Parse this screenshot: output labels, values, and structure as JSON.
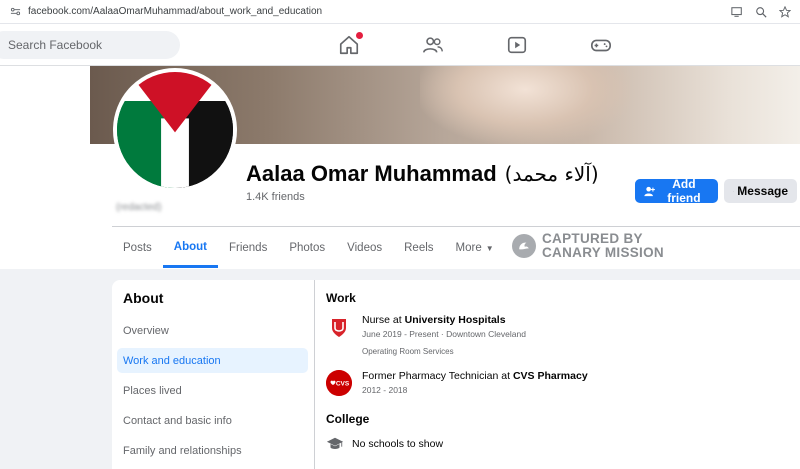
{
  "browser": {
    "url": "facebook.com/AalaaOmarMuhammad/about_work_and_education"
  },
  "topnav": {
    "search_placeholder": "Search Facebook"
  },
  "profile": {
    "name": "Aalaa Omar Muhammad",
    "alt_name": "(آلاء محمد)",
    "friends": "1.4K friends",
    "blurred_text": "(redacted)"
  },
  "actions": {
    "add_friend": "Add friend",
    "message": "Message"
  },
  "tabs": [
    {
      "label": "Posts"
    },
    {
      "label": "About"
    },
    {
      "label": "Friends"
    },
    {
      "label": "Photos"
    },
    {
      "label": "Videos"
    },
    {
      "label": "Reels"
    },
    {
      "label": "More"
    }
  ],
  "watermark": {
    "line1": "CAPTURED BY",
    "line2": "CANARY MISSION"
  },
  "about": {
    "title": "About",
    "items": [
      {
        "label": "Overview"
      },
      {
        "label": "Work and education"
      },
      {
        "label": "Places lived"
      },
      {
        "label": "Contact and basic info"
      },
      {
        "label": "Family and relationships"
      }
    ]
  },
  "work": {
    "heading": "Work",
    "entries": [
      {
        "role": "Nurse at ",
        "org": "University Hospitals",
        "dates": "June 2019 - Present · Downtown Cleveland",
        "detail": "Operating Room Services"
      },
      {
        "role": "Former Pharmacy Technician at ",
        "org": "CVS Pharmacy",
        "dates": "2012 - 2018",
        "detail": ""
      }
    ]
  },
  "college": {
    "heading": "College",
    "empty_text": "No schools to show"
  },
  "colors": {
    "accent": "#1877f2",
    "notification": "#e41e3f",
    "cvs": "#cc0000"
  }
}
